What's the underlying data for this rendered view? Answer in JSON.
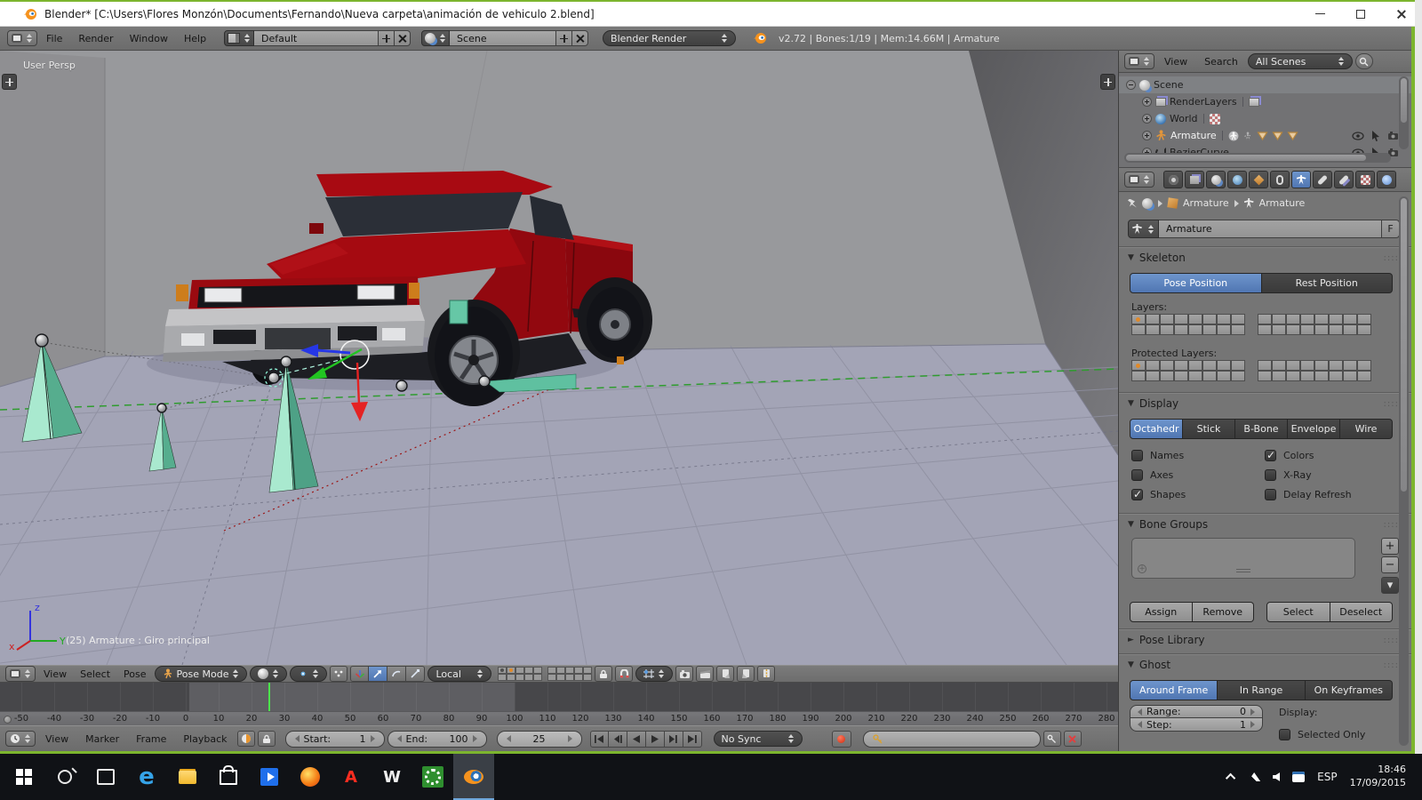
{
  "titlebar": {
    "title": "Blender* [C:\\Users\\Flores Monzón\\Documents\\Fernando\\Nueva carpeta\\animación de vehiculo 2.blend]"
  },
  "menubar": {
    "menus": [
      "File",
      "Render",
      "Window",
      "Help"
    ],
    "layout_value": "Default",
    "scene_value": "Scene",
    "engine_value": "Blender Render",
    "stats": "v2.72 | Bones:1/19  | Mem:14.66M | Armature"
  },
  "viewport": {
    "view_label": "User Persp",
    "status": "(25) Armature : Giro principal",
    "axis": {
      "x": "x",
      "y": "Y",
      "z": "z"
    },
    "header": {
      "menus": [
        "View",
        "Select",
        "Pose"
      ],
      "mode": "Pose Mode",
      "orientation": "Local"
    }
  },
  "outliner": {
    "menus": [
      "View",
      "Search"
    ],
    "filter": "All Scenes",
    "items": [
      {
        "label": "Scene"
      },
      {
        "label": "RenderLayers"
      },
      {
        "label": "World"
      },
      {
        "label": "Armature"
      },
      {
        "label": "BezierCurve"
      }
    ]
  },
  "properties": {
    "tabs": [
      {
        "icon": "render-icon"
      },
      {
        "icon": "render-layers-icon"
      },
      {
        "icon": "scene-icon"
      },
      {
        "icon": "world-icon"
      },
      {
        "icon": "object-icon"
      },
      {
        "icon": "constraints-icon"
      },
      {
        "icon": "object-data-icon",
        "active": true
      },
      {
        "icon": "bone-icon"
      },
      {
        "icon": "bone-constraints-icon"
      },
      {
        "icon": "material-icon"
      },
      {
        "icon": "physics-icon"
      }
    ],
    "breadcrumb": [
      "Armature",
      "Armature"
    ],
    "name_field": "Armature",
    "fake_user": "F",
    "skeleton": {
      "title": "Skeleton",
      "pose": "Pose Position",
      "rest": "Rest Position",
      "layers_label": "Layers:",
      "protected_label": "Protected Layers:"
    },
    "display": {
      "title": "Display",
      "modes": [
        "Octahedr",
        "Stick",
        "B-Bone",
        "Envelope",
        "Wire"
      ],
      "active_mode": "Octahedr",
      "checks": [
        {
          "label": "Names",
          "checked": false
        },
        {
          "label": "Colors",
          "checked": true
        },
        {
          "label": "Axes",
          "checked": false
        },
        {
          "label": "X-Ray",
          "checked": false
        },
        {
          "label": "Shapes",
          "checked": true
        },
        {
          "label": "Delay Refresh",
          "checked": false
        }
      ]
    },
    "bone_groups": {
      "title": "Bone Groups",
      "buttons": [
        "Assign",
        "Remove",
        "Select",
        "Deselect"
      ]
    },
    "pose_library": {
      "title": "Pose Library"
    },
    "ghost": {
      "title": "Ghost",
      "tabs": [
        "Around Frame",
        "In Range",
        "On Keyframes"
      ],
      "active_tab": "Around Frame",
      "range_label": "Range:",
      "range_value": "0",
      "step_label": "Step:",
      "step_value": "1",
      "display_label": "Display:",
      "selected_only": "Selected Only"
    }
  },
  "timeline": {
    "menus": [
      "View",
      "Marker",
      "Frame",
      "Playback"
    ],
    "start_label": "Start:",
    "start_value": "1",
    "end_label": "End:",
    "end_value": "100",
    "current": "25",
    "sync": "No Sync",
    "axis": {
      "min": -50,
      "max": 280,
      "step": 10,
      "range_start": 1,
      "range_end": 100,
      "current": 25
    },
    "ruler_ticks": [
      "-50",
      "-40",
      "-30",
      "-20",
      "-10",
      "0",
      "10",
      "20",
      "30",
      "40",
      "50",
      "60",
      "70",
      "80",
      "90",
      "100",
      "110",
      "120",
      "130",
      "140",
      "150",
      "160",
      "170",
      "180",
      "190",
      "200",
      "210",
      "220",
      "230",
      "240",
      "250",
      "260",
      "270",
      "280"
    ]
  },
  "taskbar": {
    "icons": [
      {
        "name": "start-icon"
      },
      {
        "name": "search-icon"
      },
      {
        "name": "task-view-icon"
      },
      {
        "name": "edge-icon",
        "glyph": "e"
      },
      {
        "name": "file-explorer-icon"
      },
      {
        "name": "store-icon"
      },
      {
        "name": "movies-tv-icon"
      },
      {
        "name": "firefox-icon"
      },
      {
        "name": "adobe-reader-icon",
        "glyph": "A"
      },
      {
        "name": "w-app-icon",
        "glyph": "W"
      },
      {
        "name": "settings-icon"
      },
      {
        "name": "blender-icon",
        "active": true
      }
    ],
    "lang": "ESP",
    "time": "18:46",
    "date": "17/09/2015"
  }
}
